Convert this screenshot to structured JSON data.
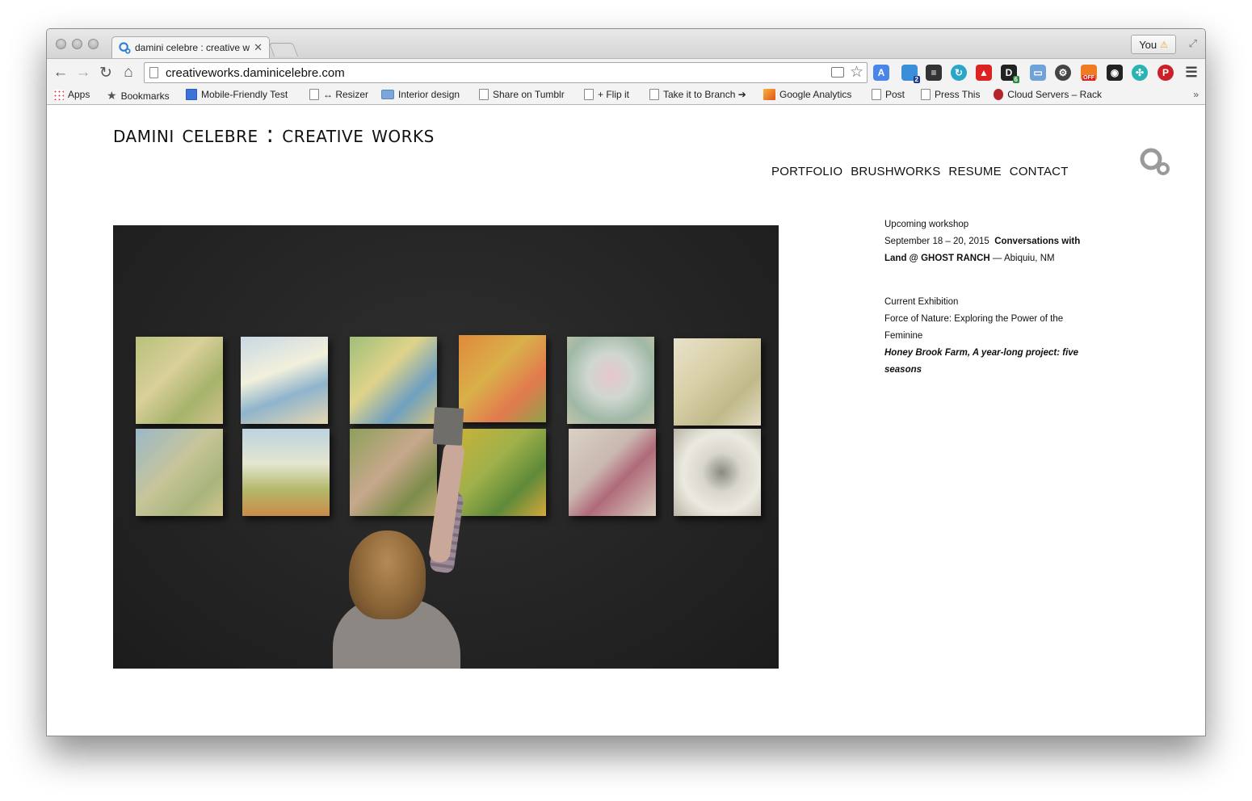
{
  "browser": {
    "tab_title": "damini celebre : creative w",
    "tab_close": "✕",
    "profile_label": "You",
    "profile_warning": "⚠",
    "url": "creativeworks.daminicelebre.com",
    "bookmarks": [
      {
        "label": "Apps",
        "icon": "apps-grid-icon"
      },
      {
        "label": "Bookmarks",
        "icon": "star-icon"
      },
      {
        "label": "Mobile-Friendly Test",
        "icon": "google-icon"
      },
      {
        "label": "↔ Resizer",
        "icon": "page-icon"
      },
      {
        "label": "Interior design",
        "icon": "folder-icon"
      },
      {
        "label": "Share on Tumblr",
        "icon": "page-icon"
      },
      {
        "label": "+ Flip it",
        "icon": "page-icon"
      },
      {
        "label": "Take it to Branch ➔",
        "icon": "page-icon"
      },
      {
        "label": "Google Analytics",
        "icon": "analytics-icon"
      },
      {
        "label": "Post",
        "icon": "page-icon"
      },
      {
        "label": "Press This",
        "icon": "page-icon"
      },
      {
        "label": "Cloud Servers – Rack",
        "icon": "rackspace-icon"
      }
    ],
    "more_bookmarks": "»",
    "extension_badges": {
      "ext2": "2",
      "ext6": "6",
      "off": "OFF"
    }
  },
  "site": {
    "title": "damini celebre : creative works",
    "nav": [
      "PORTFOLIO",
      "BRUSHWORKS",
      "RESUME",
      "CONTACT"
    ]
  },
  "sidebar": {
    "workshop_heading": "Upcoming workshop",
    "workshop_dates": "September 18 – 20, 2015",
    "workshop_title": "Conversations with Land @ GHOST RANCH",
    "workshop_location": " — Abiquiu, NM",
    "exhibition_heading": "Current Exhibition",
    "exhibition_title": "Force of Nature: Exploring the Power of the Feminine",
    "exhibition_project": "Honey Brook Farm, A year-long project: five seasons"
  },
  "colors": {
    "accent_blue": "#2a7fd6",
    "page_bg": "#ffffff",
    "hero_wall": "#262626"
  }
}
